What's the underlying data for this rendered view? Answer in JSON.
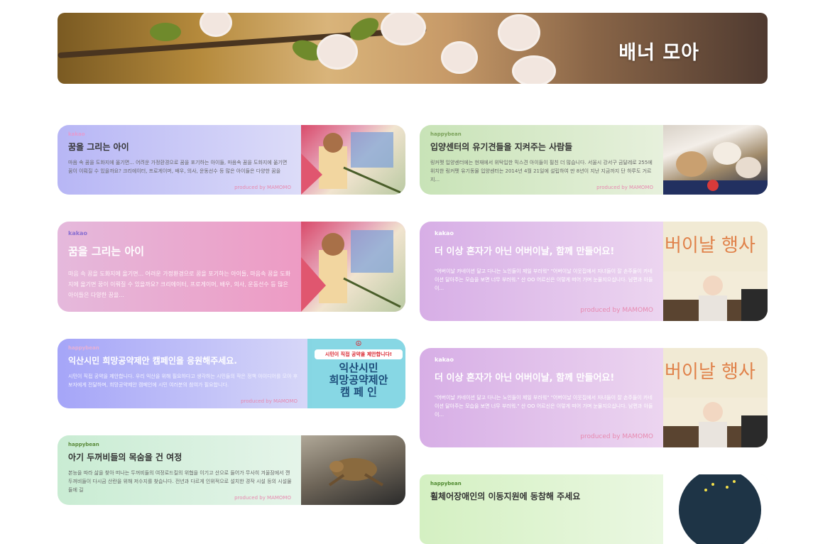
{
  "hero": {
    "title": "배너 모아"
  },
  "cards": [
    {
      "tag": "kakao",
      "title": "꿈을 그리는 아이",
      "desc": "마음 속 꿈을 도화지에 옮기면... 어려운 가정환경으로 꿈을 포기하는 아이들, 마음속 꿈을 도화지에 옮기면 꿈이 이뤄질 수 있을까요? 크리에이터, 프로게이머, 배우, 의사, 운동선수 등 많은 아이들은 다양한 꿈을",
      "credit": "produced by MAMOMO",
      "image": "child-drawing"
    },
    {
      "tag": "happybean",
      "title": "입양센터의 유기견들을 지켜주는 사람들",
      "desc": "링커펫 입양센터에는 현재에서 위탁입한 믹스견 아이들이 필친 더 많습니다. 서울시 강서구 금달레로 255에 위치한 링커펫 유기동물 입양센터는 2014년 4월 21일에 설립하여 만 8년이 지난 지금까지 단 하루도 거르지...",
      "credit": "produced by MAMOMO",
      "image": "dogs"
    },
    {
      "tag": "kakao",
      "title": "꿈을 그리는 아이",
      "desc": "마음 속 꿈을 도화지에 옮기면... 어려운 가정환경으로 꿈을 포기하는 아이들, 마음속 꿈을 도화지에 옮기면 꿈이 이뤄질 수 있을까요? 크리에이터, 프로게이머, 배우, 의사, 운동선수 등 많은 아이들은 다양한 꿈을...",
      "credit": "",
      "image": "child-drawing"
    },
    {
      "tag": "kakao",
      "title": "더 이상 혼자가 아닌 어버이날, 함께 만들어요!",
      "desc": "\"어버이날 카네이션 달고 다니는 노인들이 제일 부러워\" \"어버이날 이웃집에서 자녀들이 잘 손주들이 카네이션 달아주는 모습을 보면 너무 부러워.\" 산 OO 어르신은 이렇게 떠어 가며 눈물지으십니다. 남편과 아들이...",
      "credit": "produced by MAMOMO",
      "image": "parents-day-event"
    },
    {
      "tag": "happybean",
      "title": "익산시민 희망공약제안 캠페인을 응원해주세요.",
      "desc": "시민이 직접 공약을 제안합니다. 우리 익산을 위해 필요하다고 생각하는 시민들의 작은 정책 아이디어를 모아 후보자에게 전달하며, 희망공약제안 캠페인에 시민 여러분의 참여가 필요합니다.",
      "credit": "produced by MAMOMO",
      "image": "campaign-poster",
      "poster_top": "시민이 직접 공약을 제안합니다!",
      "poster_lines": [
        "익산시민",
        "희망공약제안",
        "캠 페 인"
      ]
    },
    {
      "tag": "kakao",
      "title": "더 이상 혼자가 아닌 어버이날, 함께 만들어요!",
      "desc": "\"어버이날 카네이션 달고 다니는 노인들이 제일 부러워\" \"어버이날 이웃집에서 자녀들이 잘 손주들이 카네이션 달아주는 모습을 보면 너무 부러워.\" 산 OO 어르신은 이렇게 떠어 가며 눈물지으십니다. 남편과 아들이...",
      "credit": "produced by MAMOMO",
      "image": "parents-day-event"
    },
    {
      "tag": "happybean",
      "title": "아기 두꺼비들의 목숨을 건 여정",
      "desc": "본능을 따라 삶을 찾아 떠나는 두꺼비들의 여정로드킬의 위협을 이기고 산으로 들어가 무사히 겨울잠에서 깬 두꺼비들이 다시금 산란을 위해 저수지를 찾습니다. 전년과 다르게 인위적으로 설치한 경작 시설 등의 시설물들에 길",
      "credit": "produced by MAMOMO",
      "image": "toad"
    },
    {
      "tag": "happybean",
      "title": "휠체어장애인의 이동지원에 동참해 주세요",
      "desc": "",
      "credit": "",
      "image": "circle-illustration"
    }
  ],
  "colors": {
    "pink_credit": "#e78ab0"
  }
}
